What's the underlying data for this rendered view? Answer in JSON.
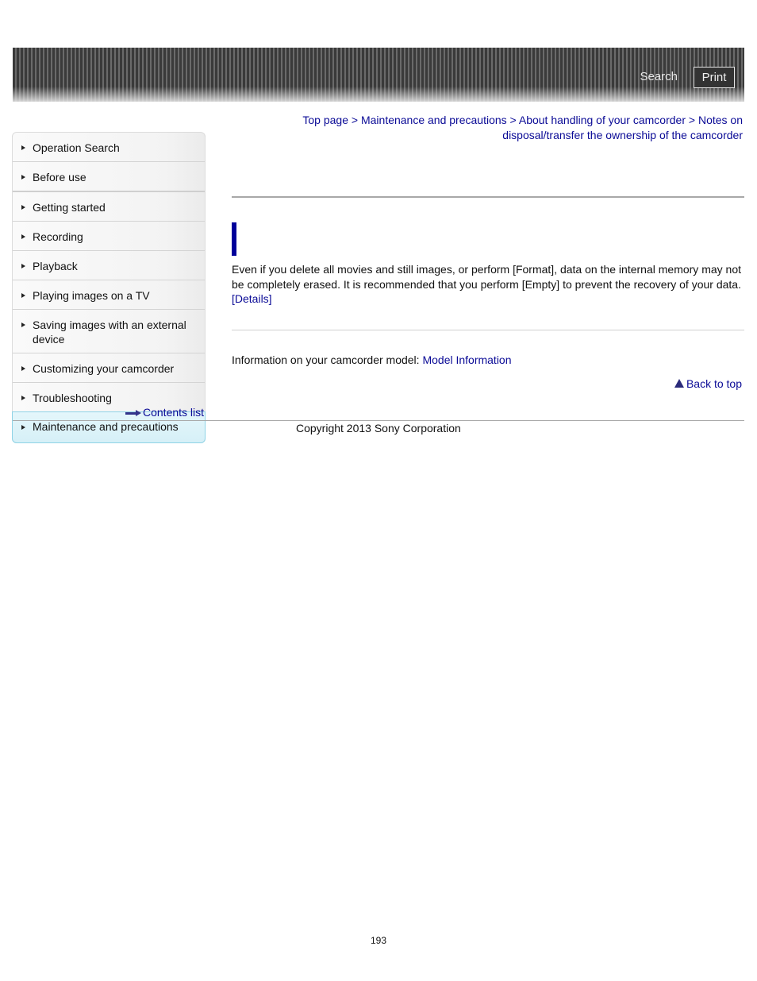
{
  "header": {
    "search_label": "Search",
    "print_label": "Print"
  },
  "breadcrumb": {
    "items": [
      {
        "label": "Top page"
      },
      {
        "label": "Maintenance and precautions"
      },
      {
        "label": "About handling of your camcorder"
      },
      {
        "label": "Notes on disposal/transfer the ownership of the camcorder"
      }
    ],
    "separator": ">"
  },
  "sidebar": {
    "items": [
      {
        "label": "Operation Search"
      },
      {
        "label": "Before use"
      },
      {
        "label": "Getting started"
      },
      {
        "label": "Recording"
      },
      {
        "label": "Playback"
      },
      {
        "label": "Playing images on a TV"
      },
      {
        "label": "Saving images with an external device"
      },
      {
        "label": "Customizing your camcorder"
      },
      {
        "label": "Troubleshooting"
      },
      {
        "label": "Maintenance and precautions",
        "active": true
      }
    ],
    "contents_list_label": "Contents list"
  },
  "main": {
    "body_text": "Even if you delete all movies and still images, or perform [Format], data on the internal memory may not be completely erased. It is recommended that you perform [Empty] to prevent the recovery of your data.",
    "details_link": "[Details]",
    "model_info_prefix": "Information on your camcorder model:",
    "model_info_link": "Model Information",
    "back_to_top": "Back to top"
  },
  "footer": {
    "copyright": "Copyright 2013 Sony Corporation",
    "page_number": "193"
  },
  "colors": {
    "link": "#0a0a96",
    "title_bar": "#00009a",
    "active_item_bg": "#d6f0f7",
    "active_item_border": "#8fd3e6"
  }
}
